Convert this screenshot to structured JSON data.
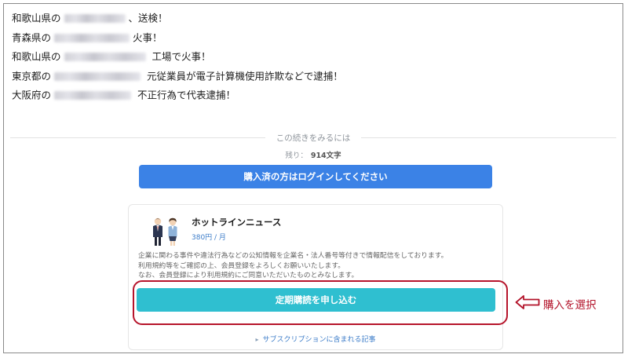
{
  "news": [
    {
      "prefix": "和歌山県の",
      "suffix": "、送検！"
    },
    {
      "prefix": "青森県の",
      "suffix": "火事！"
    },
    {
      "prefix": "和歌山県の",
      "suffix": " 工場で火事！"
    },
    {
      "prefix": "東京都の",
      "suffix": " 元従業員が電子計算機使用詐欺などで逮捕！"
    },
    {
      "prefix": "大阪府の",
      "suffix": " 不正行為で代表逮捕！"
    }
  ],
  "paywall": {
    "continue_title": "この続きをみるには",
    "remaining_label": "残り：",
    "remaining_count": "914文字",
    "login_button": "購入済の方はログインしてください"
  },
  "plan": {
    "name": "ホットラインニュース",
    "price": "380円 / 月",
    "description": [
      "企業に関わる事件や違法行為などの公知情報を企業名・法人番号等付きで情報配信をしております。",
      "利用規約等をご確認の上、会員登録をよろしくお願いいたします。",
      "なお、会員登録により利用規約にご同意いただいたものとみなします。"
    ],
    "subscribe_button": "定期購読を申し込む",
    "subscription_link": "サブスクリプションに含まれる記事"
  },
  "annotation": {
    "label": "購入を選択",
    "color": "#b3132a"
  },
  "colors": {
    "login_button": "#3b82e6",
    "subscribe_button": "#2fbfd0",
    "link": "#3d7dc9"
  }
}
